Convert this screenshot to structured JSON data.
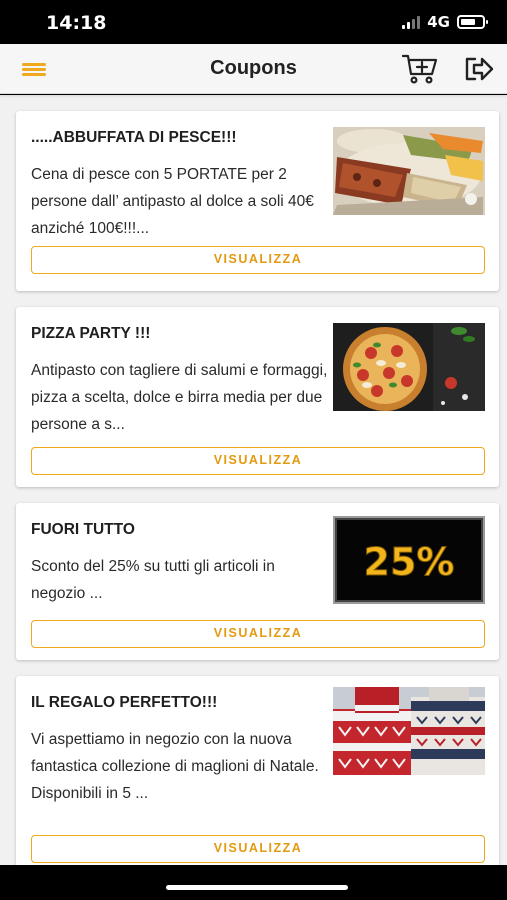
{
  "status_bar": {
    "time": "14:18",
    "network": "4G",
    "battery_level": 0.7
  },
  "header": {
    "title": "Coupons",
    "menu_icon": "hamburger-menu-icon",
    "cart_icon": "cart-add-icon",
    "logout_icon": "logout-icon"
  },
  "colors": {
    "accent": "#f0a81c",
    "header_bg": "#f6f6f6",
    "content_bg": "#f1f1f1"
  },
  "coupons": [
    {
      "title": ".....ABBUFFATA DI PESCE!!!",
      "description": "Cena di pesce con 5 PORTATE per 2 persone dall’ antipasto al dolce a soli 40€ anziché 100€!!!...",
      "image": "seafood-platter-image",
      "button_label": "VISUALIZZA"
    },
    {
      "title": "PIZZA PARTY !!!",
      "description": "Antipasto con tagliere di salumi e formaggi, pizza a scelta, dolce e birra media per due persone a s...",
      "image": "pizza-image",
      "button_label": "VISUALIZZA"
    },
    {
      "title": "FUORI TUTTO",
      "description": "Sconto del 25% su tutti gli articoli in negozio ...",
      "image": "discount-sign-image",
      "image_text": "25%",
      "button_label": "VISUALIZZA"
    },
    {
      "title": "IL REGALO PERFETTO!!!",
      "description": "Vi aspettiamo in negozio con la nuova fantastica collezione di maglioni di Natale. Disponibili in 5 ...",
      "image": "christmas-sweaters-image",
      "button_label": "VISUALIZZA"
    }
  ]
}
